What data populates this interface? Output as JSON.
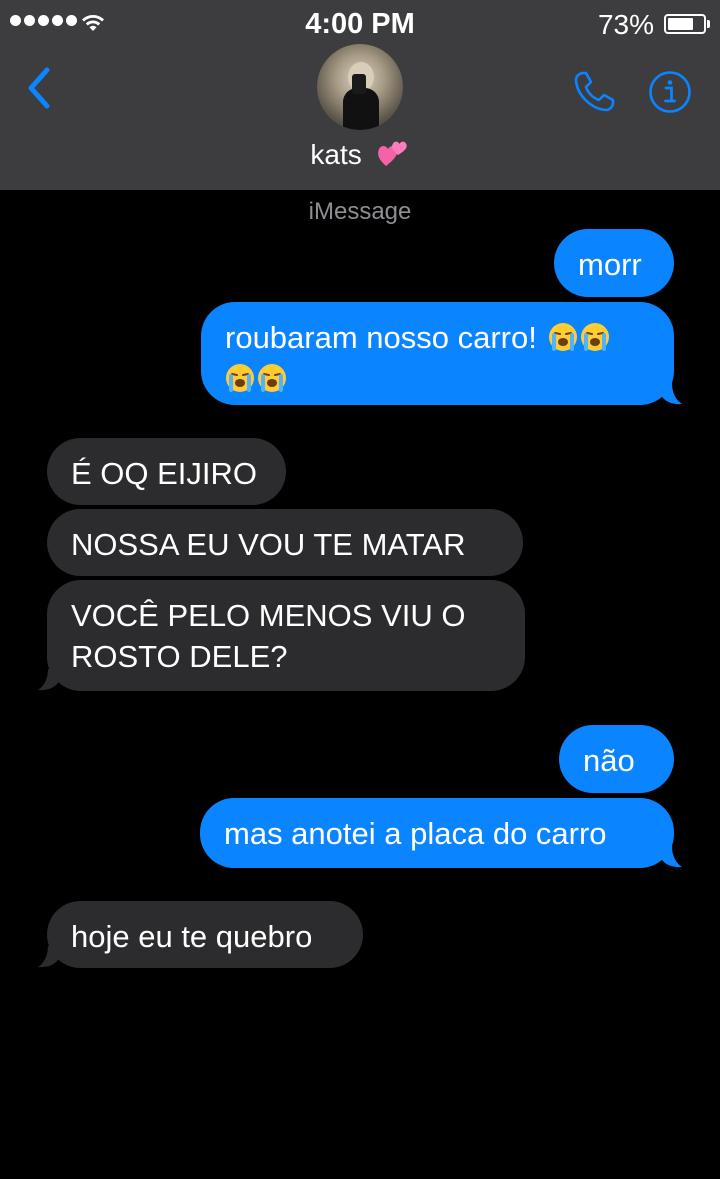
{
  "status_bar": {
    "time": "4:00 PM",
    "battery_percent_text": "73%",
    "battery_level": 0.73,
    "signal_bars": 5
  },
  "header": {
    "contact_name": "kats",
    "contact_emoji": "two-hearts",
    "back_icon": "chevron-left-icon",
    "call_icon": "phone-icon",
    "info_icon": "info-icon",
    "accent_color": "#0a84ff"
  },
  "conversation": {
    "service_label": "iMessage",
    "messages": [
      {
        "direction": "outgoing",
        "text": "morr"
      },
      {
        "direction": "outgoing",
        "text": "roubaram nosso carro!",
        "line2": "",
        "emoji": "loudly-crying-face x4"
      },
      {
        "direction": "incoming",
        "text": "É OQ EIJIRO"
      },
      {
        "direction": "incoming",
        "text": "NOSSA EU VOU TE MATAR"
      },
      {
        "direction": "incoming",
        "text": "VOCÊ PELO MENOS VIU O",
        "line2": "ROSTO DELE?"
      },
      {
        "direction": "outgoing",
        "text": "não"
      },
      {
        "direction": "outgoing",
        "text": "mas anotei a placa do carro"
      },
      {
        "direction": "incoming",
        "text": "hoje eu te quebro"
      }
    ]
  },
  "colors": {
    "outgoing_bubble": "#0a84ff",
    "incoming_bubble": "#2c2c2e",
    "header_bg": "#3d3d3f",
    "background": "#000000"
  }
}
